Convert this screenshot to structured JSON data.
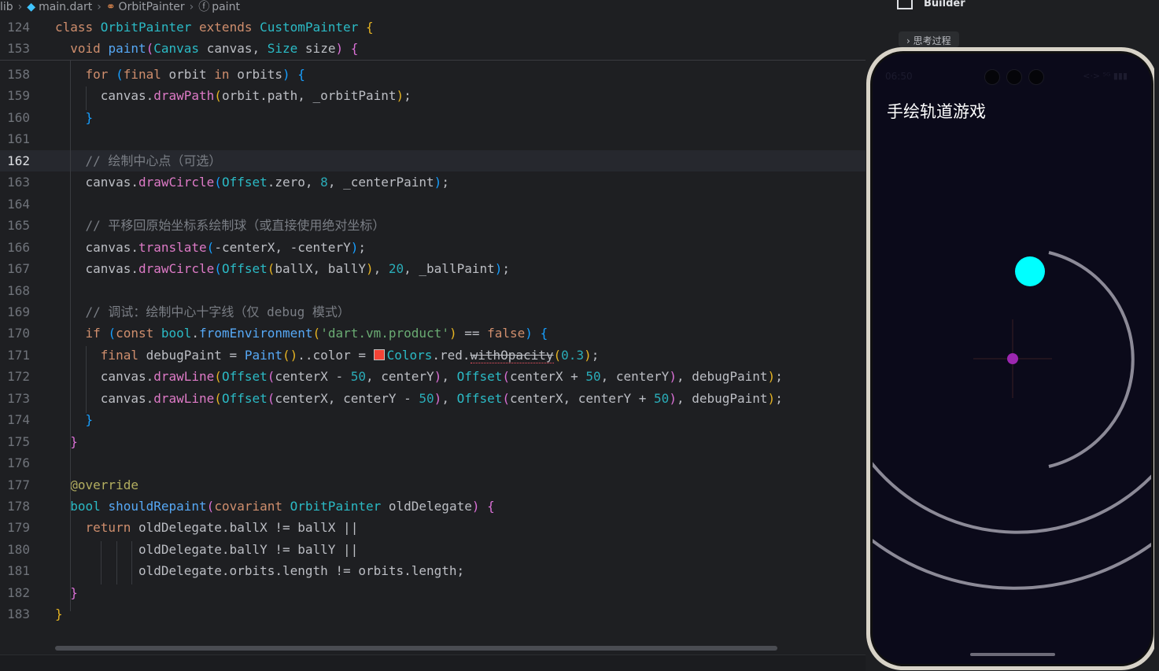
{
  "breadcrumb": {
    "items": [
      "lib",
      "main.dart",
      "OrbitPainter",
      "paint"
    ]
  },
  "editor": {
    "sticky_lines": [
      {
        "num": "124",
        "tokens": [
          [
            "kw",
            "class "
          ],
          [
            "cls",
            "OrbitPainter "
          ],
          [
            "kw",
            "extends "
          ],
          [
            "cls",
            "CustomPainter "
          ],
          [
            "brk1",
            "{"
          ]
        ]
      },
      {
        "num": "153",
        "tokens": [
          [
            "",
            "  "
          ],
          [
            "kw",
            "void "
          ],
          [
            "fn",
            "paint"
          ],
          [
            "brk2",
            "("
          ],
          [
            "cls",
            "Canvas "
          ],
          [
            "",
            "canvas, "
          ],
          [
            "cls",
            "Size "
          ],
          [
            "",
            "size"
          ],
          [
            "brk2",
            ") "
          ],
          [
            "brk2",
            "{"
          ]
        ]
      }
    ],
    "lines": [
      {
        "num": "158",
        "tokens": [
          [
            "",
            "    "
          ],
          [
            "kw",
            "for "
          ],
          [
            "brk3",
            "("
          ],
          [
            "kw",
            "final "
          ],
          [
            "",
            "orbit "
          ],
          [
            "kw",
            "in "
          ],
          [
            "",
            "orbits"
          ],
          [
            "brk3",
            ") "
          ],
          [
            "brk3",
            "{"
          ]
        ]
      },
      {
        "num": "159",
        "tokens": [
          [
            "",
            "      canvas."
          ],
          [
            "mth",
            "drawPath"
          ],
          [
            "brk1",
            "("
          ],
          [
            "",
            "orbit.path, _orbitPaint"
          ],
          [
            "brk1",
            ")"
          ],
          [
            "",
            ";"
          ]
        ]
      },
      {
        "num": "160",
        "tokens": [
          [
            "",
            "    "
          ],
          [
            "brk3",
            "}"
          ]
        ]
      },
      {
        "num": "161",
        "tokens": []
      },
      {
        "num": "162",
        "tokens": [
          [
            "",
            "    "
          ],
          [
            "cmt",
            "// 绘制中心点（可选）"
          ]
        ],
        "current": true
      },
      {
        "num": "163",
        "tokens": [
          [
            "",
            "    canvas."
          ],
          [
            "mth",
            "drawCircle"
          ],
          [
            "brk3",
            "("
          ],
          [
            "cls",
            "Offset"
          ],
          [
            "",
            ".zero, "
          ],
          [
            "num",
            "8"
          ],
          [
            "",
            ", _centerPaint"
          ],
          [
            "brk3",
            ")"
          ],
          [
            "",
            ";"
          ]
        ]
      },
      {
        "num": "164",
        "tokens": []
      },
      {
        "num": "165",
        "tokens": [
          [
            "",
            "    "
          ],
          [
            "cmt",
            "// 平移回原始坐标系绘制球（或直接使用绝对坐标）"
          ]
        ]
      },
      {
        "num": "166",
        "tokens": [
          [
            "",
            "    canvas."
          ],
          [
            "mth",
            "translate"
          ],
          [
            "brk3",
            "("
          ],
          [
            "",
            "-centerX, -centerY"
          ],
          [
            "brk3",
            ")"
          ],
          [
            "",
            ";"
          ]
        ]
      },
      {
        "num": "167",
        "tokens": [
          [
            "",
            "    canvas."
          ],
          [
            "mth",
            "drawCircle"
          ],
          [
            "brk3",
            "("
          ],
          [
            "cls",
            "Offset"
          ],
          [
            "brk1",
            "("
          ],
          [
            "",
            "ballX, ballY"
          ],
          [
            "brk1",
            ")"
          ],
          [
            "",
            ", "
          ],
          [
            "num",
            "20"
          ],
          [
            "",
            ", _ballPaint"
          ],
          [
            "brk3",
            ")"
          ],
          [
            "",
            ";"
          ]
        ]
      },
      {
        "num": "168",
        "tokens": []
      },
      {
        "num": "169",
        "tokens": [
          [
            "",
            "    "
          ],
          [
            "cmt",
            "// 调试：绘制中心十字线（仅 debug 模式）"
          ]
        ]
      },
      {
        "num": "170",
        "tokens": [
          [
            "",
            "    "
          ],
          [
            "kw",
            "if "
          ],
          [
            "brk3",
            "("
          ],
          [
            "kw",
            "const "
          ],
          [
            "cls",
            "bool"
          ],
          [
            "",
            "."
          ],
          [
            "fn",
            "fromEnvironment"
          ],
          [
            "brk1",
            "("
          ],
          [
            "str",
            "'dart.vm.product'"
          ],
          [
            "brk1",
            ")"
          ],
          [
            "",
            " == "
          ],
          [
            "kw",
            "false"
          ],
          [
            "brk3",
            ") "
          ],
          [
            "brk3",
            "{"
          ]
        ]
      },
      {
        "num": "171",
        "tokens": [
          [
            "",
            "      "
          ],
          [
            "kw",
            "final "
          ],
          [
            "",
            "debugPaint = "
          ],
          [
            "fn",
            "Paint"
          ],
          [
            "brk1",
            "()"
          ],
          [
            "",
            "..color = "
          ],
          [
            "swatch",
            ""
          ],
          [
            "cls",
            "Colors"
          ],
          [
            "",
            ".red."
          ],
          [
            "dep",
            "withOpacity"
          ],
          [
            "brk1",
            "("
          ],
          [
            "num",
            "0.3"
          ],
          [
            "brk1",
            ")"
          ],
          [
            "",
            ";"
          ]
        ]
      },
      {
        "num": "172",
        "tokens": [
          [
            "",
            "      canvas."
          ],
          [
            "mth",
            "drawLine"
          ],
          [
            "brk1",
            "("
          ],
          [
            "cls",
            "Offset"
          ],
          [
            "brk2",
            "("
          ],
          [
            "",
            "centerX - "
          ],
          [
            "num",
            "50"
          ],
          [
            "",
            ", centerY"
          ],
          [
            "brk2",
            ")"
          ],
          [
            "",
            ", "
          ],
          [
            "cls",
            "Offset"
          ],
          [
            "brk2",
            "("
          ],
          [
            "",
            "centerX + "
          ],
          [
            "num",
            "50"
          ],
          [
            "",
            ", centerY"
          ],
          [
            "brk2",
            ")"
          ],
          [
            "",
            ", debugPaint"
          ],
          [
            "brk1",
            ")"
          ],
          [
            "",
            ";"
          ]
        ]
      },
      {
        "num": "173",
        "tokens": [
          [
            "",
            "      canvas."
          ],
          [
            "mth",
            "drawLine"
          ],
          [
            "brk1",
            "("
          ],
          [
            "cls",
            "Offset"
          ],
          [
            "brk2",
            "("
          ],
          [
            "",
            "centerX, centerY - "
          ],
          [
            "num",
            "50"
          ],
          [
            "brk2",
            ")"
          ],
          [
            "",
            ", "
          ],
          [
            "cls",
            "Offset"
          ],
          [
            "brk2",
            "("
          ],
          [
            "",
            "centerX, centerY + "
          ],
          [
            "num",
            "50"
          ],
          [
            "brk2",
            ")"
          ],
          [
            "",
            ", debugPaint"
          ],
          [
            "brk1",
            ")"
          ],
          [
            "",
            ";"
          ]
        ]
      },
      {
        "num": "174",
        "tokens": [
          [
            "",
            "    "
          ],
          [
            "brk3",
            "}"
          ]
        ]
      },
      {
        "num": "175",
        "tokens": [
          [
            "",
            "  "
          ],
          [
            "brk2",
            "}"
          ]
        ]
      },
      {
        "num": "176",
        "tokens": []
      },
      {
        "num": "177",
        "tokens": [
          [
            "",
            "  "
          ],
          [
            "ann",
            "@override"
          ]
        ]
      },
      {
        "num": "178",
        "tokens": [
          [
            "",
            "  "
          ],
          [
            "cls",
            "bool "
          ],
          [
            "fn",
            "shouldRepaint"
          ],
          [
            "brk2",
            "("
          ],
          [
            "kw",
            "covariant "
          ],
          [
            "cls",
            "OrbitPainter "
          ],
          [
            "",
            "oldDelegate"
          ],
          [
            "brk2",
            ") "
          ],
          [
            "brk2",
            "{"
          ]
        ]
      },
      {
        "num": "179",
        "tokens": [
          [
            "",
            "    "
          ],
          [
            "kw",
            "return "
          ],
          [
            "",
            "oldDelegate.ballX != ballX ||"
          ]
        ]
      },
      {
        "num": "180",
        "tokens": [
          [
            "",
            "           oldDelegate.ballY != ballY ||"
          ]
        ]
      },
      {
        "num": "181",
        "tokens": [
          [
            "",
            "           oldDelegate.orbits.length != orbits.length;"
          ]
        ]
      },
      {
        "num": "182",
        "tokens": [
          [
            "",
            "  "
          ],
          [
            "brk2",
            "}"
          ]
        ]
      },
      {
        "num": "183",
        "tokens": [
          [
            "brk1",
            "}"
          ]
        ]
      }
    ]
  },
  "assistant_panel": {
    "header": "Builder",
    "thinking_chip": "› 思考过程"
  },
  "phone": {
    "status_time": "06:50",
    "status_right": "<·> ⁵ᴳ ▮▮▮",
    "app_title": "手绘轨道游戏",
    "colors": {
      "background": "#0b0a1a",
      "orbit": "#8c8a97",
      "ball": "#00ffff",
      "center": "#9c27b0",
      "debug_line": "#3a1e24"
    }
  }
}
